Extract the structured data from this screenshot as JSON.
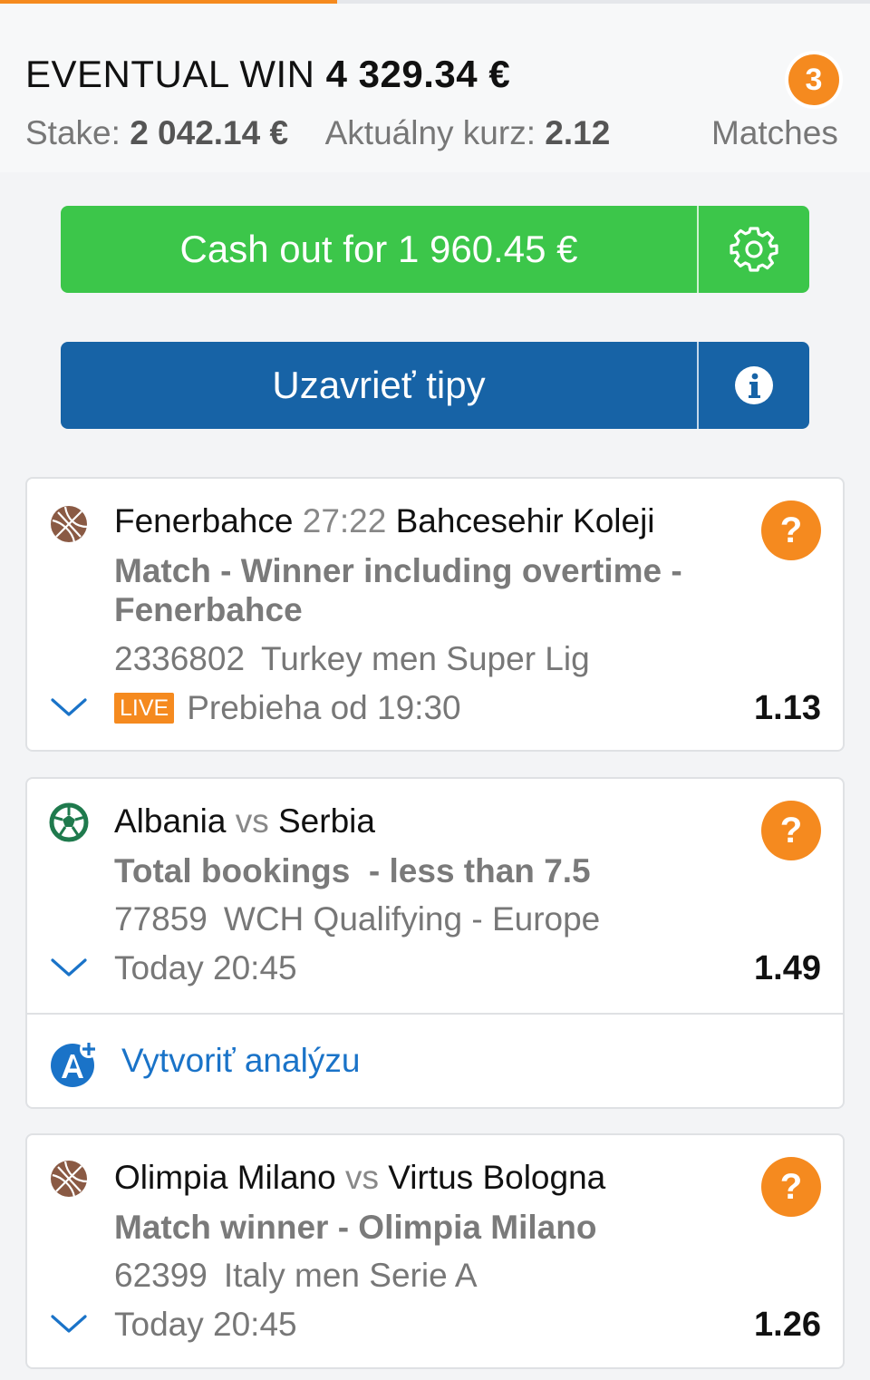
{
  "summary": {
    "eventual_label": "EVENTUAL WIN",
    "eventual_value": "4 329.34 €",
    "stake_label": "Stake:",
    "stake_value": "2 042.14 €",
    "odds_label": "Aktuálny kurz:",
    "odds_value": "2.12",
    "match_count": "3",
    "matches_label": "Matches"
  },
  "actions": {
    "cashout_label": "Cash out for 1 960.45 €",
    "close_label": "Uzavrieť tipy"
  },
  "bets": [
    {
      "sport_icon": "basketball-icon",
      "home": "Fenerbahce",
      "separator": "27:22",
      "away": "Bahcesehir Koleji",
      "market": "Match - Winner including overtime - Fenerbahce",
      "event_id": "2336802",
      "league": "Turkey men Super Lig",
      "live_badge": "LIVE",
      "time": "Prebieha od 19:30",
      "odds": "1.13",
      "help": "?"
    },
    {
      "sport_icon": "football-icon",
      "home": "Albania",
      "separator": "vs",
      "away": "Serbia",
      "market": "Total bookings  - less than 7.5",
      "event_id": "77859",
      "league": "WCH Qualifying - Europe",
      "time": "Today 20:45",
      "odds": "1.49",
      "help": "?",
      "analysis_label": "Vytvoriť analýzu"
    },
    {
      "sport_icon": "basketball-icon",
      "home": "Olimpia Milano",
      "separator": "vs",
      "away": "Virtus Bologna",
      "market": "Match winner - Olimpia Milano",
      "event_id": "62399",
      "league": "Italy men Serie A",
      "time": "Today 20:45",
      "odds": "1.26",
      "help": "?"
    }
  ],
  "colors": {
    "accent_orange": "#f58a1f",
    "cashout_green": "#3cc64a",
    "close_blue": "#1763a6",
    "link_blue": "#1a73c8"
  }
}
